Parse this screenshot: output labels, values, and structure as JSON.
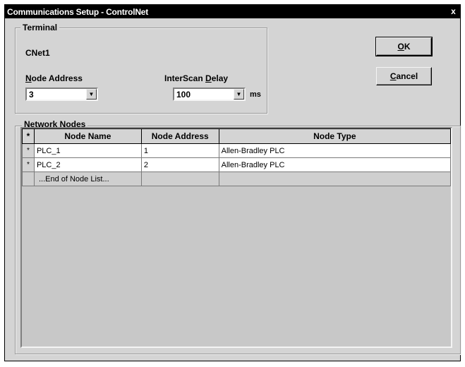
{
  "window": {
    "title": "Communications Setup - ControlNet",
    "close_glyph": "x"
  },
  "terminal": {
    "legend": "Terminal",
    "name": "CNet1",
    "node_address_label_u": "N",
    "node_address_label_rest": "ode Address",
    "node_address_value": "3",
    "interscan_label_pre": "InterScan ",
    "interscan_label_u": "D",
    "interscan_label_rest": "elay",
    "interscan_value": "100",
    "interscan_unit": "ms"
  },
  "buttons": {
    "ok_u": "O",
    "ok_rest": "K",
    "cancel_u": "C",
    "cancel_rest": "ancel"
  },
  "network_nodes": {
    "legend": "Network Nodes",
    "columns": [
      "*",
      "Node Name",
      "Node Address",
      "Node Type"
    ],
    "rows": [
      {
        "marker": "*",
        "name": "PLC_1",
        "address": "1",
        "type": "Allen-Bradley PLC"
      },
      {
        "marker": "*",
        "name": "PLC_2",
        "address": "2",
        "type": "Allen-Bradley PLC"
      }
    ],
    "end_row": "...End of Node List..."
  },
  "icons": {
    "dropdown": "chevron-down-icon",
    "close": "close-icon"
  },
  "colors": {
    "titlebar": "#000000",
    "dialog_bg": "#d4d4d4",
    "grid_bg": "#c8c8c8"
  }
}
